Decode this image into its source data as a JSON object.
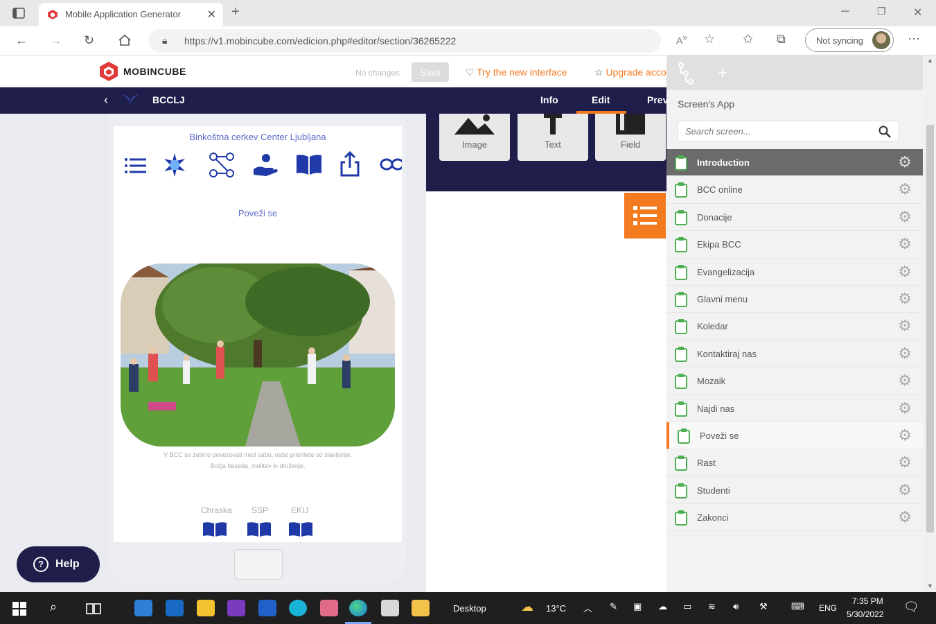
{
  "browser": {
    "tab_title": "Mobile Application Generator",
    "url": "https://v1.mobincube.com/edicion.php#editor/section/36265222",
    "sync_label": "Not syncing"
  },
  "app_header": {
    "logo_text": "MOBINCUBE",
    "status": "No changes",
    "save_label": "Save",
    "try_new": "Try the new interface",
    "upgrade": "Upgrade account"
  },
  "nav": {
    "app_name": "BCCLJ",
    "tabs": [
      "Info",
      "Edit",
      "Preview"
    ],
    "active_tab": "Edit"
  },
  "tools": [
    "Image",
    "Text",
    "Field"
  ],
  "phone": {
    "church_title": "Binkoštna cerkev Center Ljubljana",
    "section_title": "Poveži se",
    "caption": "V BCC se želimo povezovati med sabo, naše prioritete so slavljenje, Božja beseda, molitev in druženje.",
    "books": [
      "Chraska",
      "SSP",
      "EKIJ"
    ]
  },
  "help_label": "Help",
  "right_panel": {
    "title": "Screen's App",
    "search_placeholder": "Search screen...",
    "screens": [
      "Introduction",
      "BCC online",
      "Donacije",
      "Ekipa BCC",
      "Evangelizacija",
      "Glavni menu",
      "Koledar",
      "Kontaktiraj nas",
      "Mozaik",
      "Najdi nas",
      "Poveži se",
      "Rast",
      "Studenti",
      "Zakonci"
    ],
    "active_screen": "Introduction",
    "current_screen": "Poveži se"
  },
  "taskbar": {
    "desktop_label": "Desktop",
    "weather": "13°C",
    "lang": "ENG",
    "time": "7:35 PM",
    "date": "5/30/2022"
  },
  "colors": {
    "accent": "#f47a20",
    "navy": "#1f1d4a",
    "phone_text": "#5a6bc8"
  }
}
